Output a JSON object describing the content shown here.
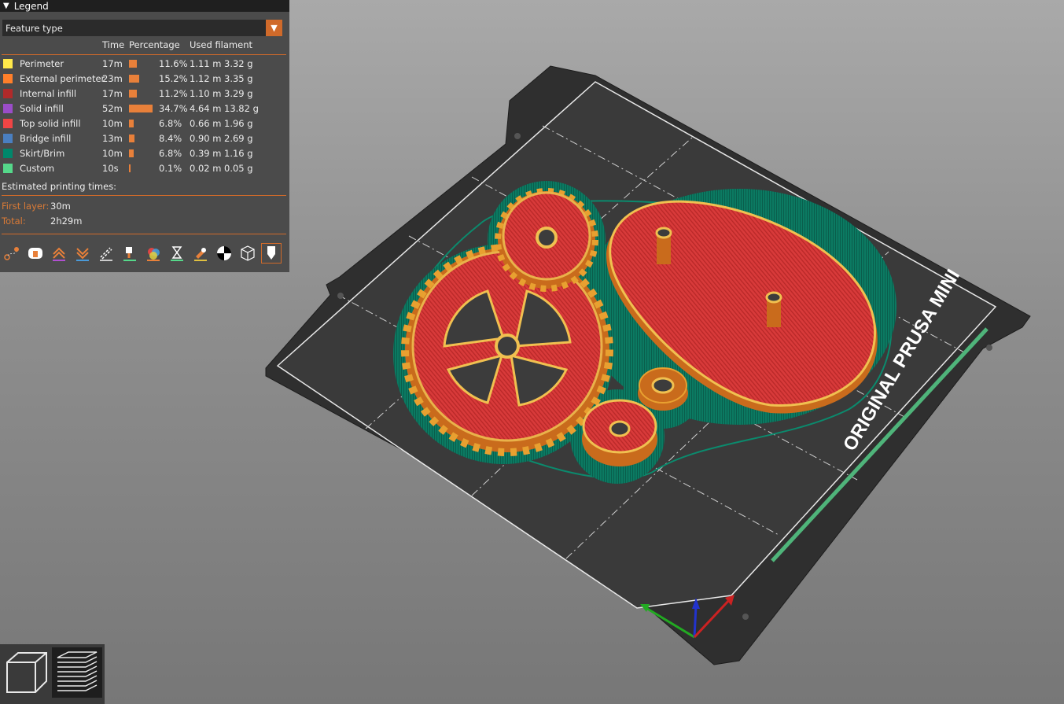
{
  "legend": {
    "title": "Legend",
    "view_type": "Feature type",
    "columns": {
      "time": "Time",
      "percentage": "Percentage",
      "used_filament": "Used filament"
    },
    "rows": [
      {
        "name": "Perimeter",
        "color": "#ffe84a",
        "time": "17m",
        "pct": "11.6%",
        "pct_value": 11.6,
        "length": "1.11 m",
        "weight": "3.32 g"
      },
      {
        "name": "External perimeter",
        "color": "#ff7f2a",
        "time": "23m",
        "pct": "15.2%",
        "pct_value": 15.2,
        "length": "1.12 m",
        "weight": "3.35 g"
      },
      {
        "name": "Internal infill",
        "color": "#b02a2a",
        "time": "17m",
        "pct": "11.2%",
        "pct_value": 11.2,
        "length": "1.10 m",
        "weight": "3.29 g"
      },
      {
        "name": "Solid infill",
        "color": "#9a4dc8",
        "time": "52m",
        "pct": "34.7%",
        "pct_value": 34.7,
        "length": "4.64 m",
        "weight": "13.82 g"
      },
      {
        "name": "Top solid infill",
        "color": "#f04545",
        "time": "10m",
        "pct": "6.8%",
        "pct_value": 6.8,
        "length": "0.66 m",
        "weight": "1.96 g"
      },
      {
        "name": "Bridge infill",
        "color": "#4a7fc0",
        "time": "13m",
        "pct": "8.4%",
        "pct_value": 8.4,
        "length": "0.90 m",
        "weight": "2.69 g"
      },
      {
        "name": "Skirt/Brim",
        "color": "#00876b",
        "time": "10m",
        "pct": "6.8%",
        "pct_value": 6.8,
        "length": "0.39 m",
        "weight": "1.16 g"
      },
      {
        "name": "Custom",
        "color": "#55d88a",
        "time": "10s",
        "pct": "0.1%",
        "pct_value": 0.1,
        "length": "0.02 m",
        "weight": "0.05 g"
      }
    ],
    "estimated_label": "Estimated printing times:",
    "first_layer_label": "First layer:",
    "first_layer_value": "30m",
    "total_label": "Total:",
    "total_value": "2h29m",
    "toolbar": [
      "travel-icon",
      "wipe-icon",
      "retractions-icon",
      "deretractions-icon",
      "seams-icon",
      "tool-changes-icon",
      "color-changes-icon",
      "pause-prints-icon",
      "custom-gcode-icon",
      "center-of-gravity-icon",
      "shells-icon",
      "tool-marker-icon"
    ]
  },
  "bed": {
    "label": "ORIGINAL PRUSA MINI"
  },
  "view_buttons": [
    "3d-view-icon",
    "layers-preview-icon"
  ]
}
